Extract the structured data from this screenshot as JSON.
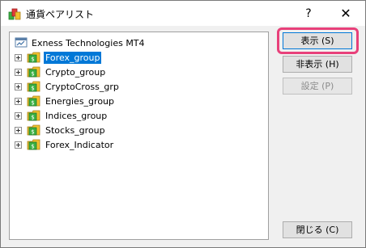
{
  "window": {
    "title": "通貨ペアリスト",
    "help_label": "?",
    "close_label": "✕"
  },
  "tree": {
    "root": {
      "label": "Exness Technologies MT4",
      "icon": "server-icon"
    },
    "items": [
      {
        "label": "Forex_group",
        "selected": true,
        "icon": "folder-symbol-icon"
      },
      {
        "label": "Crypto_group",
        "selected": false,
        "icon": "folder-symbol-icon"
      },
      {
        "label": "CryptoCross_grp",
        "selected": false,
        "icon": "folder-symbol-icon"
      },
      {
        "label": "Energies_group",
        "selected": false,
        "icon": "folder-symbol-icon"
      },
      {
        "label": "Indices_group",
        "selected": false,
        "icon": "folder-symbol-icon"
      },
      {
        "label": "Stocks_group",
        "selected": false,
        "icon": "folder-symbol-icon"
      },
      {
        "label": "Forex_Indicator",
        "selected": false,
        "icon": "folder-symbol-icon"
      }
    ]
  },
  "buttons": {
    "show": "表示 (S)",
    "hide": "非表示 (H)",
    "settings": "設定 (P)",
    "close": "閉じる (C)"
  },
  "colors": {
    "selection": "#0078d7",
    "highlight_ring": "#e8407a",
    "folder_green": "#3cb043",
    "folder_yellow": "#f2c12e"
  }
}
